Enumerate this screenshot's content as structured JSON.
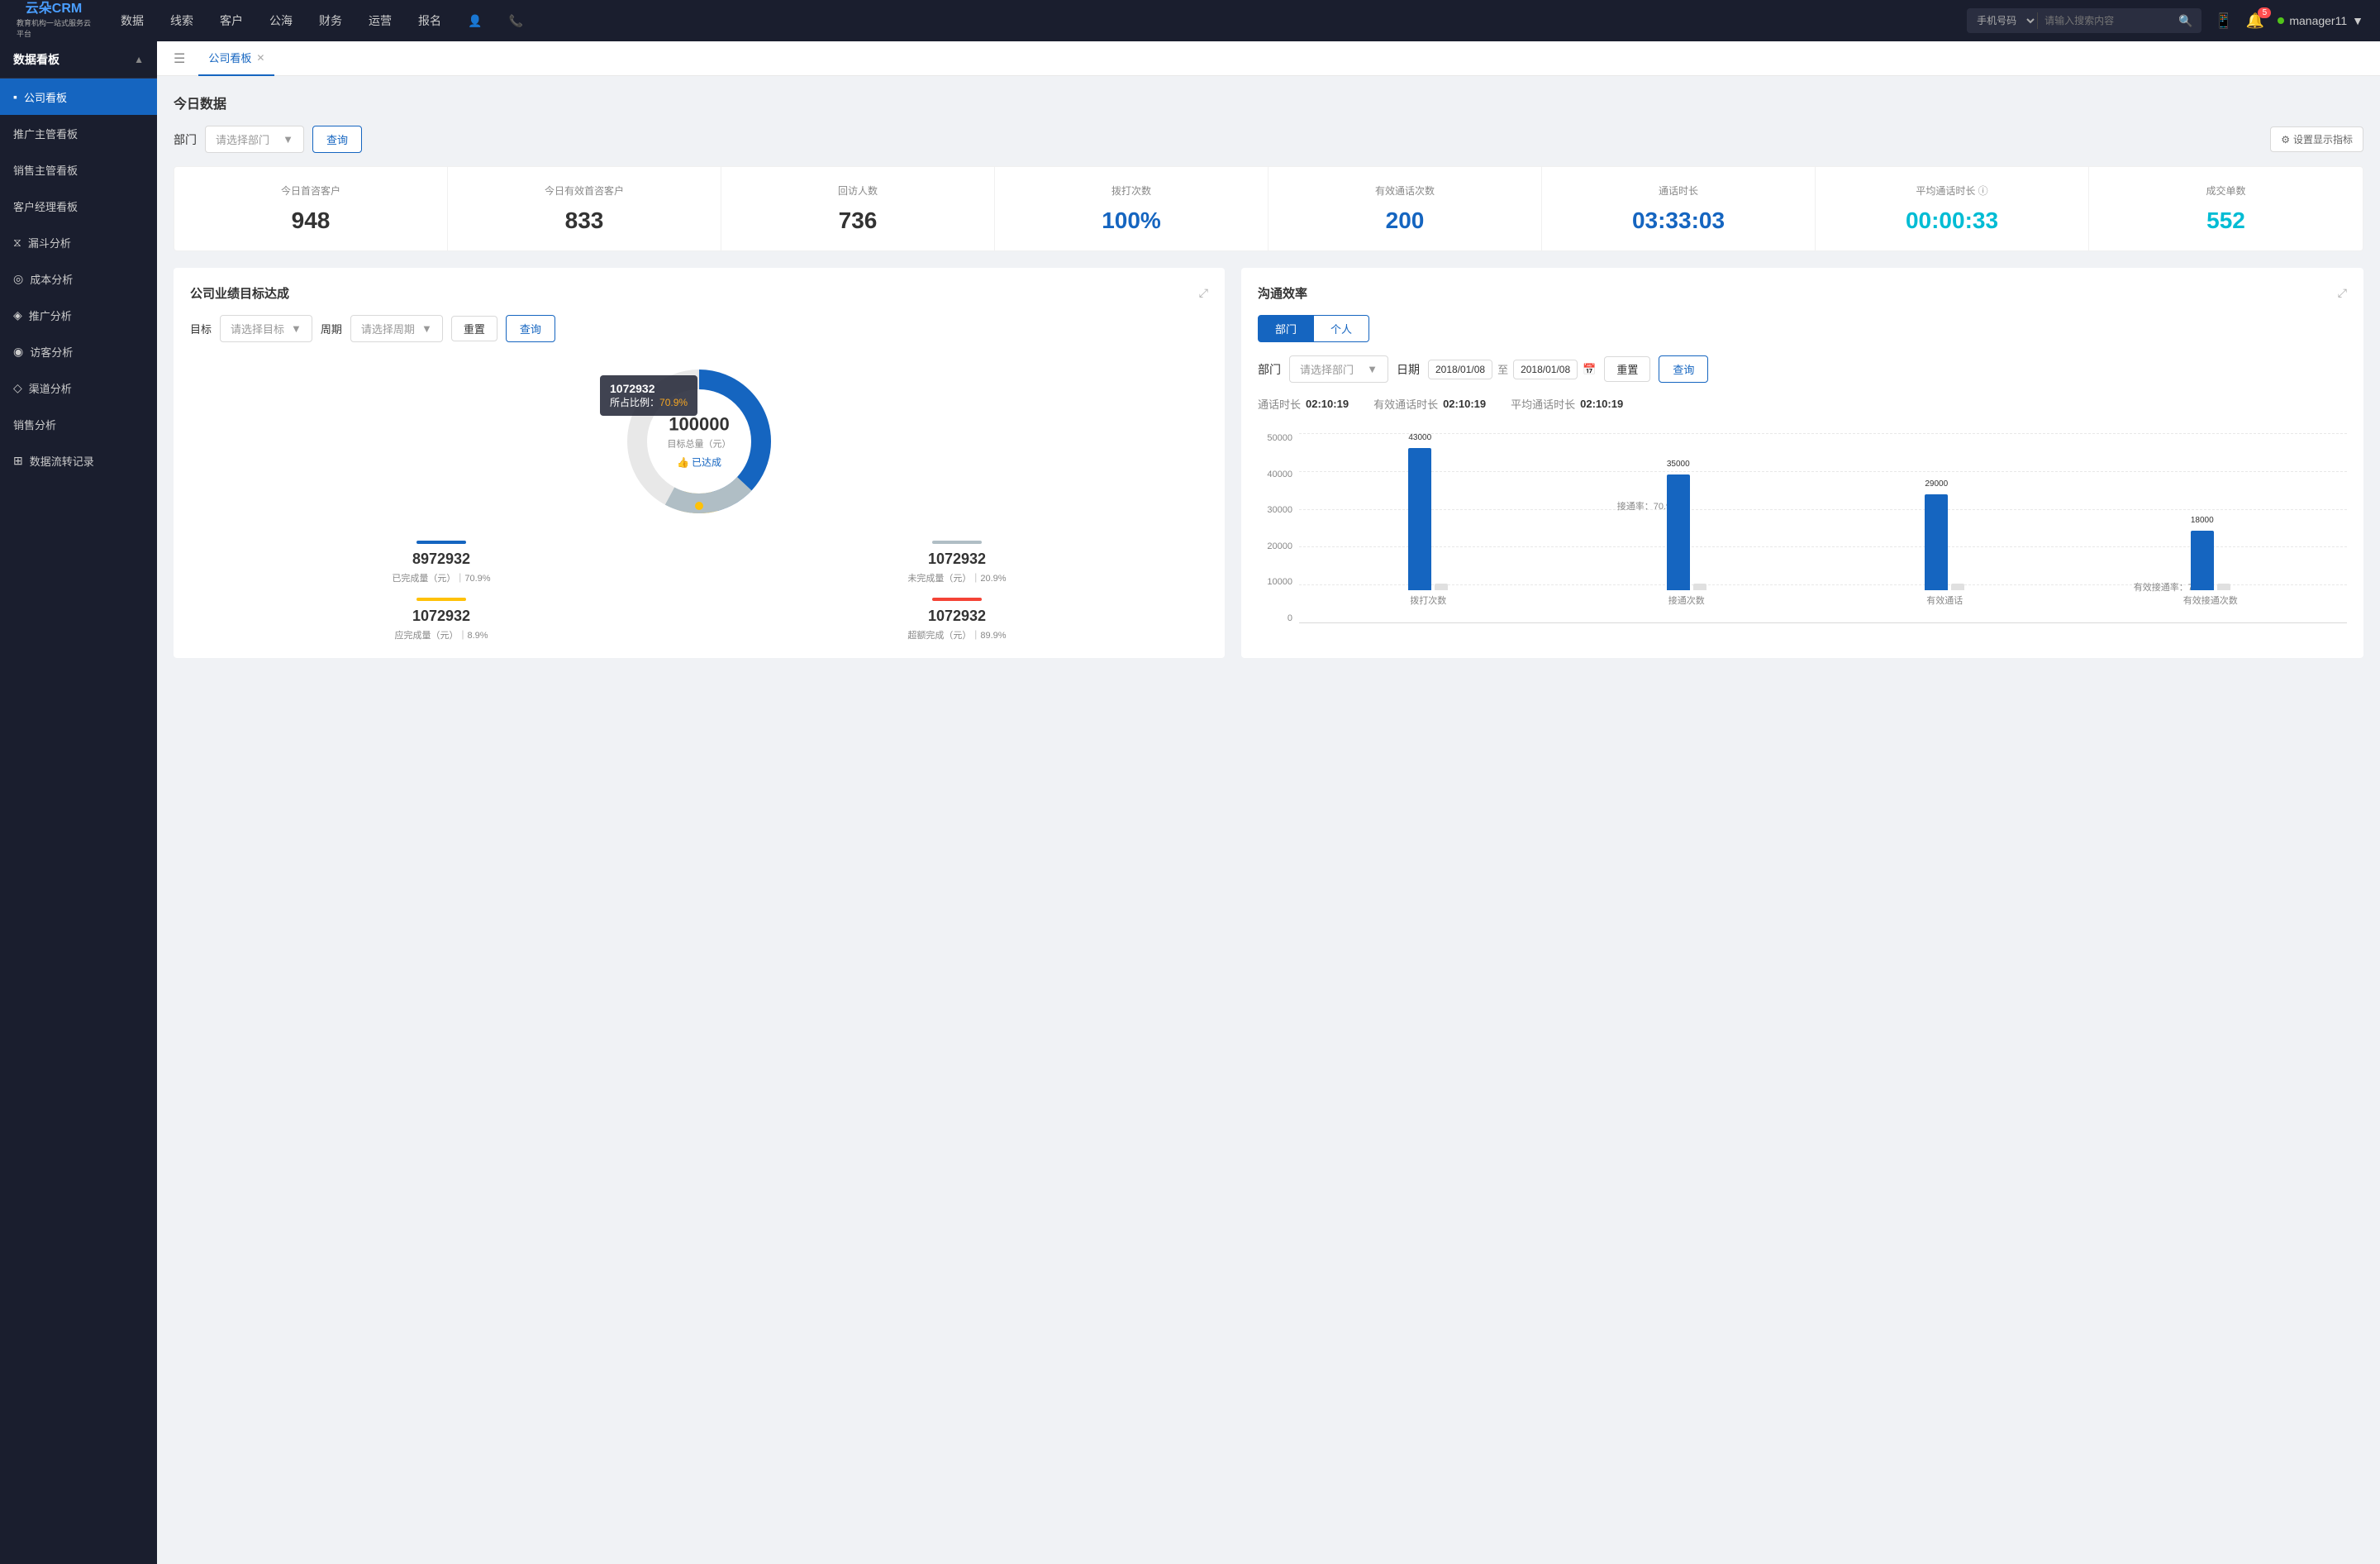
{
  "topnav": {
    "logo_main": "云朵CRM",
    "logo_sub": "教育机构一站式服务云平台",
    "nav_items": [
      "数据",
      "线索",
      "客户",
      "公海",
      "财务",
      "运营",
      "报名"
    ],
    "search_placeholder": "请输入搜索内容",
    "search_type": "手机号码",
    "notification_count": "5",
    "username": "manager11"
  },
  "sidebar": {
    "section_title": "数据看板",
    "items": [
      {
        "label": "公司看板",
        "active": true
      },
      {
        "label": "推广主管看板",
        "active": false
      },
      {
        "label": "销售主管看板",
        "active": false
      },
      {
        "label": "客户经理看板",
        "active": false
      },
      {
        "label": "漏斗分析",
        "active": false
      },
      {
        "label": "成本分析",
        "active": false
      },
      {
        "label": "推广分析",
        "active": false
      },
      {
        "label": "访客分析",
        "active": false
      },
      {
        "label": "渠道分析",
        "active": false
      },
      {
        "label": "销售分析",
        "active": false
      },
      {
        "label": "数据流转记录",
        "active": false
      }
    ]
  },
  "tabs": [
    {
      "label": "公司看板",
      "active": true
    }
  ],
  "today_data": {
    "title": "今日数据",
    "filter_label": "部门",
    "filter_placeholder": "请选择部门",
    "query_btn": "查询",
    "settings_btn": "设置显示指标",
    "stats": [
      {
        "label": "今日首咨客户",
        "value": "948",
        "color": "black"
      },
      {
        "label": "今日有效首咨客户",
        "value": "833",
        "color": "black"
      },
      {
        "label": "回访人数",
        "value": "736",
        "color": "black"
      },
      {
        "label": "拨打次数",
        "value": "100%",
        "color": "blue"
      },
      {
        "label": "有效通话次数",
        "value": "200",
        "color": "blue"
      },
      {
        "label": "通话时长",
        "value": "03:33:03",
        "color": "blue"
      },
      {
        "label": "平均通话时长",
        "value": "00:00:33",
        "color": "cyan"
      },
      {
        "label": "成交单数",
        "value": "552",
        "color": "cyan"
      }
    ]
  },
  "goal_panel": {
    "title": "公司业绩目标达成",
    "target_label": "目标",
    "target_placeholder": "请选择目标",
    "period_label": "周期",
    "period_placeholder": "请选择周期",
    "reset_btn": "重置",
    "query_btn": "查询",
    "donut": {
      "center_value": "100000",
      "center_label": "目标总量（元）",
      "center_badge": "已达成",
      "tooltip_value": "1072932",
      "tooltip_ratio_label": "所占比例：",
      "tooltip_ratio": "70.9%",
      "blue_pct": 70.9,
      "orange_pct": 8.9,
      "red_pct": 20.9
    },
    "stats": [
      {
        "label": "已完成量（元）｜70.9%",
        "value": "8972932",
        "bar_color": "#1565c0"
      },
      {
        "label": "未完成量（元）｜20.9%",
        "value": "1072932",
        "bar_color": "#b0bec5"
      },
      {
        "label": "应完成量（元）｜8.9%",
        "value": "1072932",
        "bar_color": "#ffc107"
      },
      {
        "label": "超额完成（元）｜89.9%",
        "value": "1072932",
        "bar_color": "#f44336"
      }
    ]
  },
  "comm_panel": {
    "title": "沟通效率",
    "tab_dept": "部门",
    "tab_personal": "个人",
    "dept_label": "部门",
    "dept_placeholder": "请选择部门",
    "date_label": "日期",
    "date_from": "2018/01/08",
    "date_to": "2018/01/08",
    "reset_btn": "重置",
    "query_btn": "查询",
    "summary": {
      "talk_label": "通话时长",
      "talk_value": "02:10:19",
      "effective_label": "有效通话时长",
      "effective_value": "02:10:19",
      "avg_label": "平均通话时长",
      "avg_value": "02:10:19"
    },
    "chart": {
      "y_labels": [
        "50000",
        "40000",
        "30000",
        "20000",
        "10000",
        "0"
      ],
      "groups": [
        {
          "label": "拨打次数",
          "bars": [
            {
              "value": 43000,
              "label": "43000",
              "color": "blue"
            },
            {
              "value": 0,
              "label": "",
              "color": "light"
            }
          ]
        },
        {
          "label": "接通次数",
          "annotation": "接通率：70.9%",
          "bars": [
            {
              "value": 35000,
              "label": "35000",
              "color": "blue"
            },
            {
              "value": 0,
              "label": "",
              "color": "light"
            }
          ]
        },
        {
          "label": "有效通话",
          "bars": [
            {
              "value": 29000,
              "label": "29000",
              "color": "blue"
            },
            {
              "value": 0,
              "label": "",
              "color": "light"
            }
          ]
        },
        {
          "label": "有效接通次数",
          "annotation": "有效接通率：70.9%",
          "bars": [
            {
              "value": 18000,
              "label": "18000",
              "color": "blue"
            },
            {
              "value": 0,
              "label": "",
              "color": "light"
            }
          ]
        }
      ],
      "max_value": 50000
    }
  }
}
